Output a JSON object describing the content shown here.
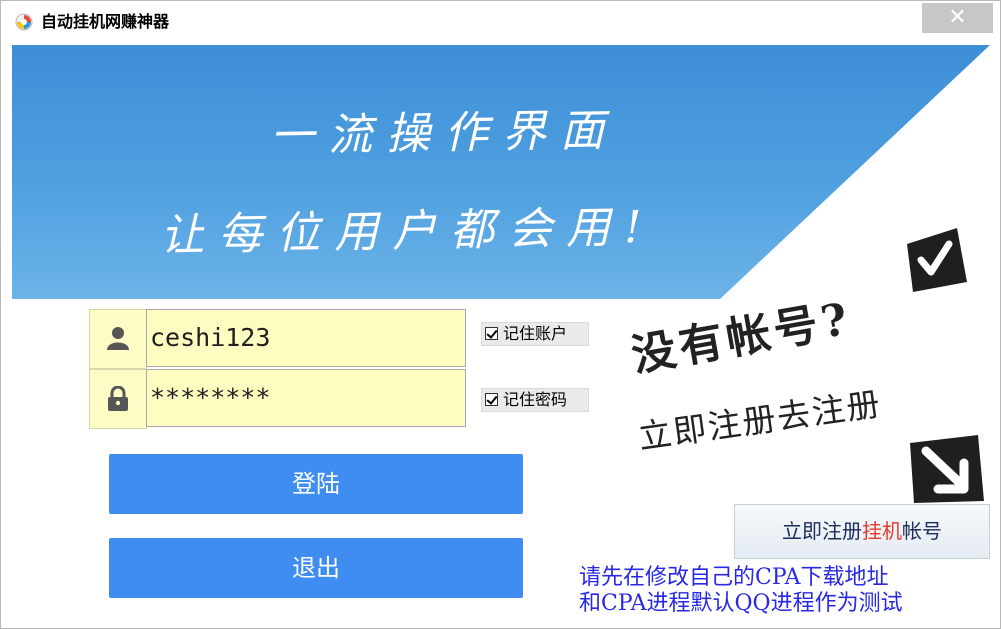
{
  "window": {
    "title": "自动挂机网赚神器",
    "close_glyph": "✕",
    "app_icon": "app-logo-icon"
  },
  "banner": {
    "slogan_line1": "一流操作界面",
    "slogan_line2": "让每位用户都会用!",
    "background_color": "#4a9be0"
  },
  "login": {
    "username_value": "ceshi123",
    "password_value": "********",
    "remember_account_label": "记住账户",
    "remember_account_checked": true,
    "remember_password_label": "记住密码",
    "remember_password_checked": true,
    "login_label": "登陆",
    "exit_label": "退出",
    "button_color": "#3f8df1",
    "input_bg_color": "#fdfdc2"
  },
  "promo": {
    "line1": "没有帐号?",
    "line2": "立即注册去注册",
    "register_button": {
      "part1": "立即注册",
      "part2": "挂机",
      "part3": "帐号",
      "highlight_color": "#e53a2c"
    }
  },
  "notice": {
    "line1": "请先在修改自己的CPA下载地址",
    "line2": "和CPA进程默认QQ进程作为测试",
    "color": "#2828e6"
  }
}
